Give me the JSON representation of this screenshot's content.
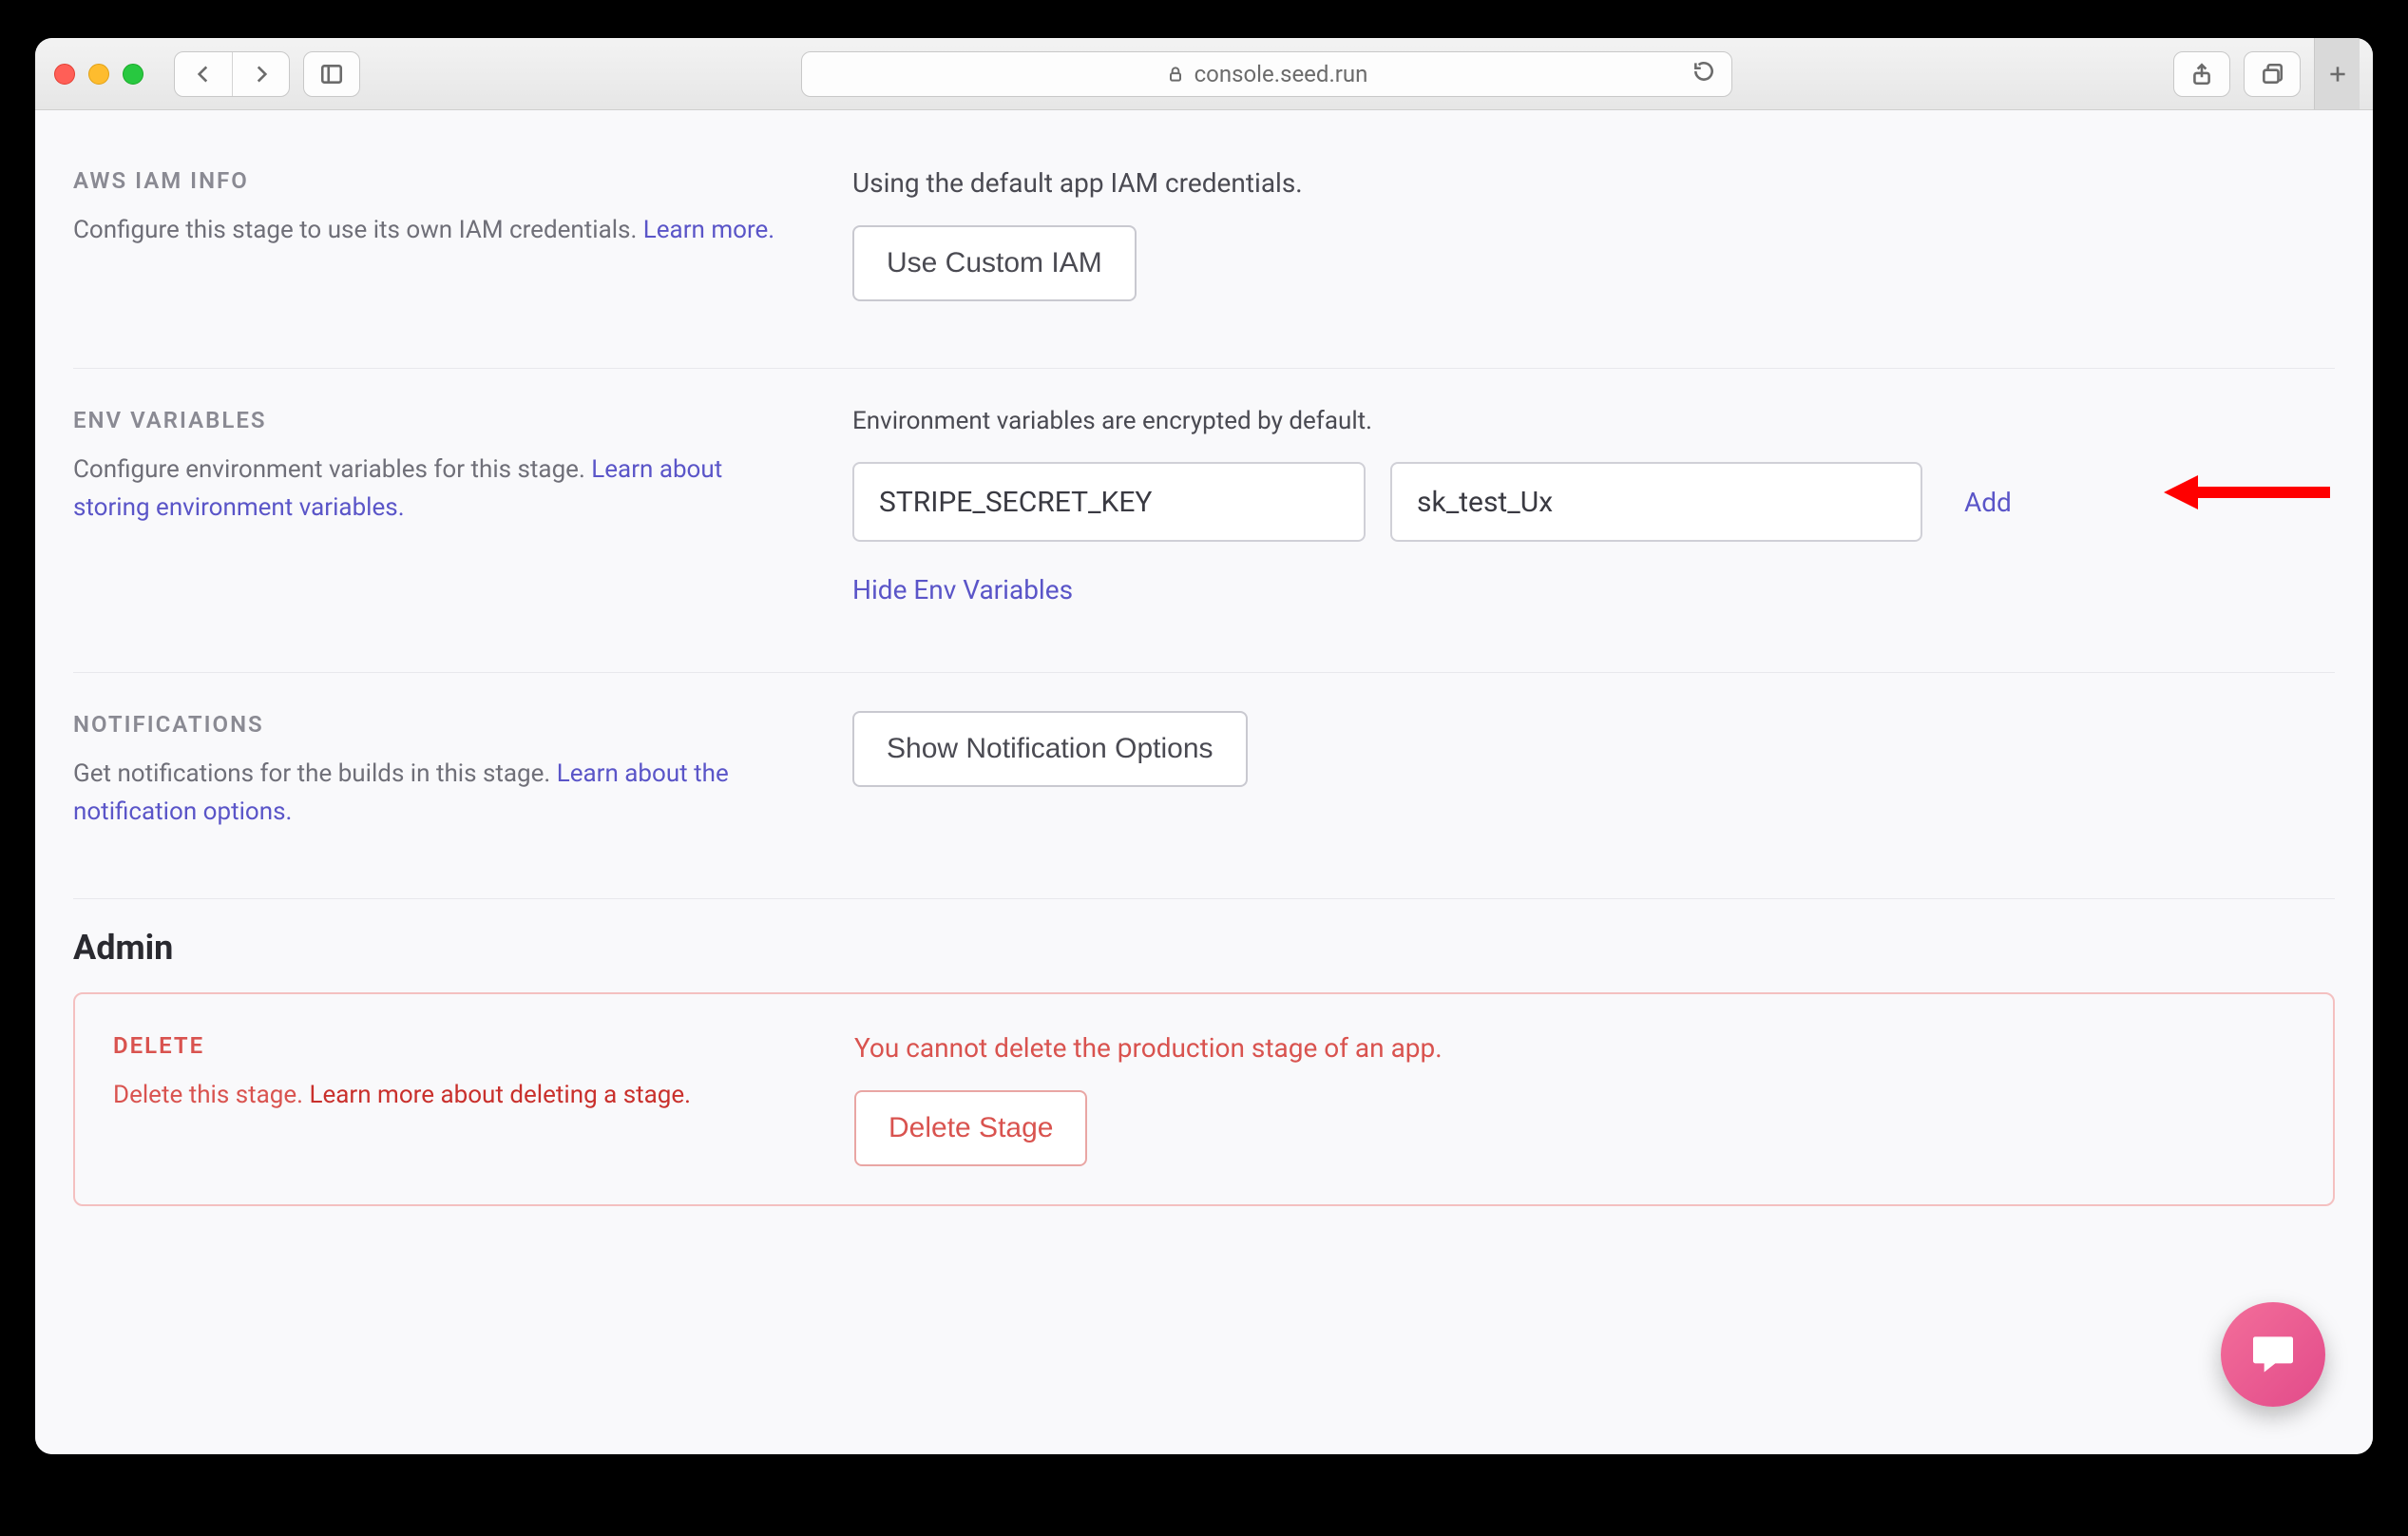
{
  "browser": {
    "url": "console.seed.run"
  },
  "sections": {
    "iam": {
      "title": "AWS IAM INFO",
      "desc_prefix": "Configure this stage to use its own IAM credentials. ",
      "learn": "Learn more.",
      "lead": "Using the default app IAM credentials.",
      "button": "Use Custom IAM"
    },
    "env": {
      "title": "ENV VARIABLES",
      "desc_prefix": "Configure environment variables for this stage. ",
      "learn": "Learn about storing environment variables.",
      "lead": "Environment variables are encrypted by default.",
      "key": "STRIPE_SECRET_KEY",
      "val": "sk_test_Ux",
      "add": "Add",
      "hide": "Hide Env Variables"
    },
    "notif": {
      "title": "NOTIFICATIONS",
      "desc_prefix": "Get notifications for the builds in this stage. ",
      "learn": "Learn about the notification options.",
      "button": "Show Notification Options"
    },
    "admin": {
      "heading": "Admin",
      "delete_title": "DELETE",
      "delete_desc_prefix": "Delete this stage. ",
      "delete_learn": "Learn more about deleting a stage.",
      "delete_lead": "You cannot delete the production stage of an app.",
      "delete_button": "Delete Stage"
    }
  }
}
